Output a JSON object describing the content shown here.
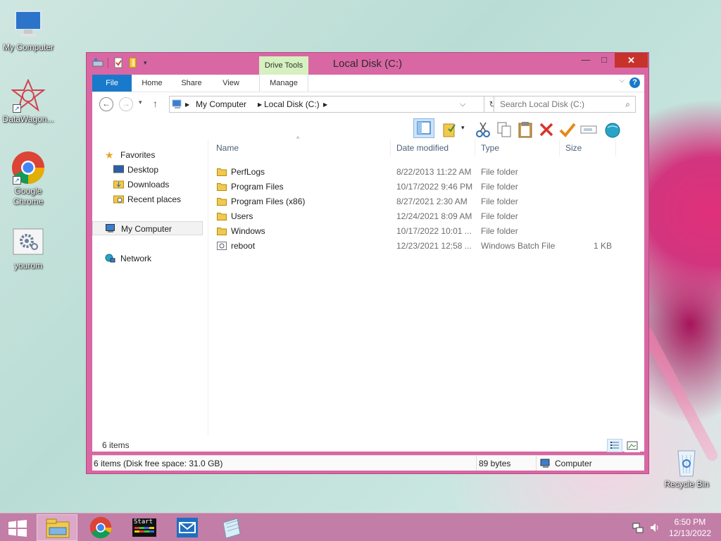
{
  "desktop": {
    "icons": [
      {
        "label": "My Computer"
      },
      {
        "label": "DataWagon..."
      },
      {
        "label": "Google Chrome"
      },
      {
        "label": "yourom"
      },
      {
        "label": "Recycle Bin"
      }
    ]
  },
  "window": {
    "title": "Local Disk (C:)",
    "close": "✕",
    "minimize": "—",
    "maximize": "□"
  },
  "ribbon": {
    "tabs": [
      "File",
      "Home",
      "Share",
      "View",
      "Manage"
    ],
    "contextual_label": "Drive Tools",
    "help": "?"
  },
  "address": {
    "crumbs": [
      "My Computer",
      "Local Disk (C:)"
    ],
    "search_placeholder": "Search Local Disk (C:)"
  },
  "nav_pane": {
    "favorites": "Favorites",
    "desktop": "Desktop",
    "downloads": "Downloads",
    "recent": "Recent places",
    "my_computer": "My Computer",
    "network": "Network"
  },
  "columns": {
    "name": "Name",
    "date": "Date modified",
    "type": "Type",
    "size": "Size"
  },
  "files": [
    {
      "name": "PerfLogs",
      "date": "8/22/2013 11:22 AM",
      "type": "File folder",
      "size": "",
      "icon": "folder"
    },
    {
      "name": "Program Files",
      "date": "10/17/2022 9:46 PM",
      "type": "File folder",
      "size": "",
      "icon": "folder"
    },
    {
      "name": "Program Files (x86)",
      "date": "8/27/2021 2:30 AM",
      "type": "File folder",
      "size": "",
      "icon": "folder"
    },
    {
      "name": "Users",
      "date": "12/24/2021 8:09 AM",
      "type": "File folder",
      "size": "",
      "icon": "folder"
    },
    {
      "name": "Windows",
      "date": "10/17/2022 10:01 ...",
      "type": "File folder",
      "size": "",
      "icon": "folder"
    },
    {
      "name": "reboot",
      "date": "12/23/2021 12:58 ...",
      "type": "Windows Batch File",
      "size": "1 KB",
      "icon": "batch-file"
    }
  ],
  "item_count": "6 items",
  "status": {
    "left": "6 items (Disk free space: 31.0 GB)",
    "bytes": "89 bytes",
    "location": "Computer"
  },
  "tray": {
    "time": "6:50 PM",
    "date": "12/13/2022"
  },
  "taskbar_apps": [
    {
      "name": "Start",
      "label": "Start"
    }
  ],
  "colors": {
    "window_frame": "#d967a3",
    "file_tab": "#1979ca",
    "contextual_tab": "#d6f0c0",
    "close_button": "#c7332a",
    "taskbar": "#c27ea7"
  }
}
